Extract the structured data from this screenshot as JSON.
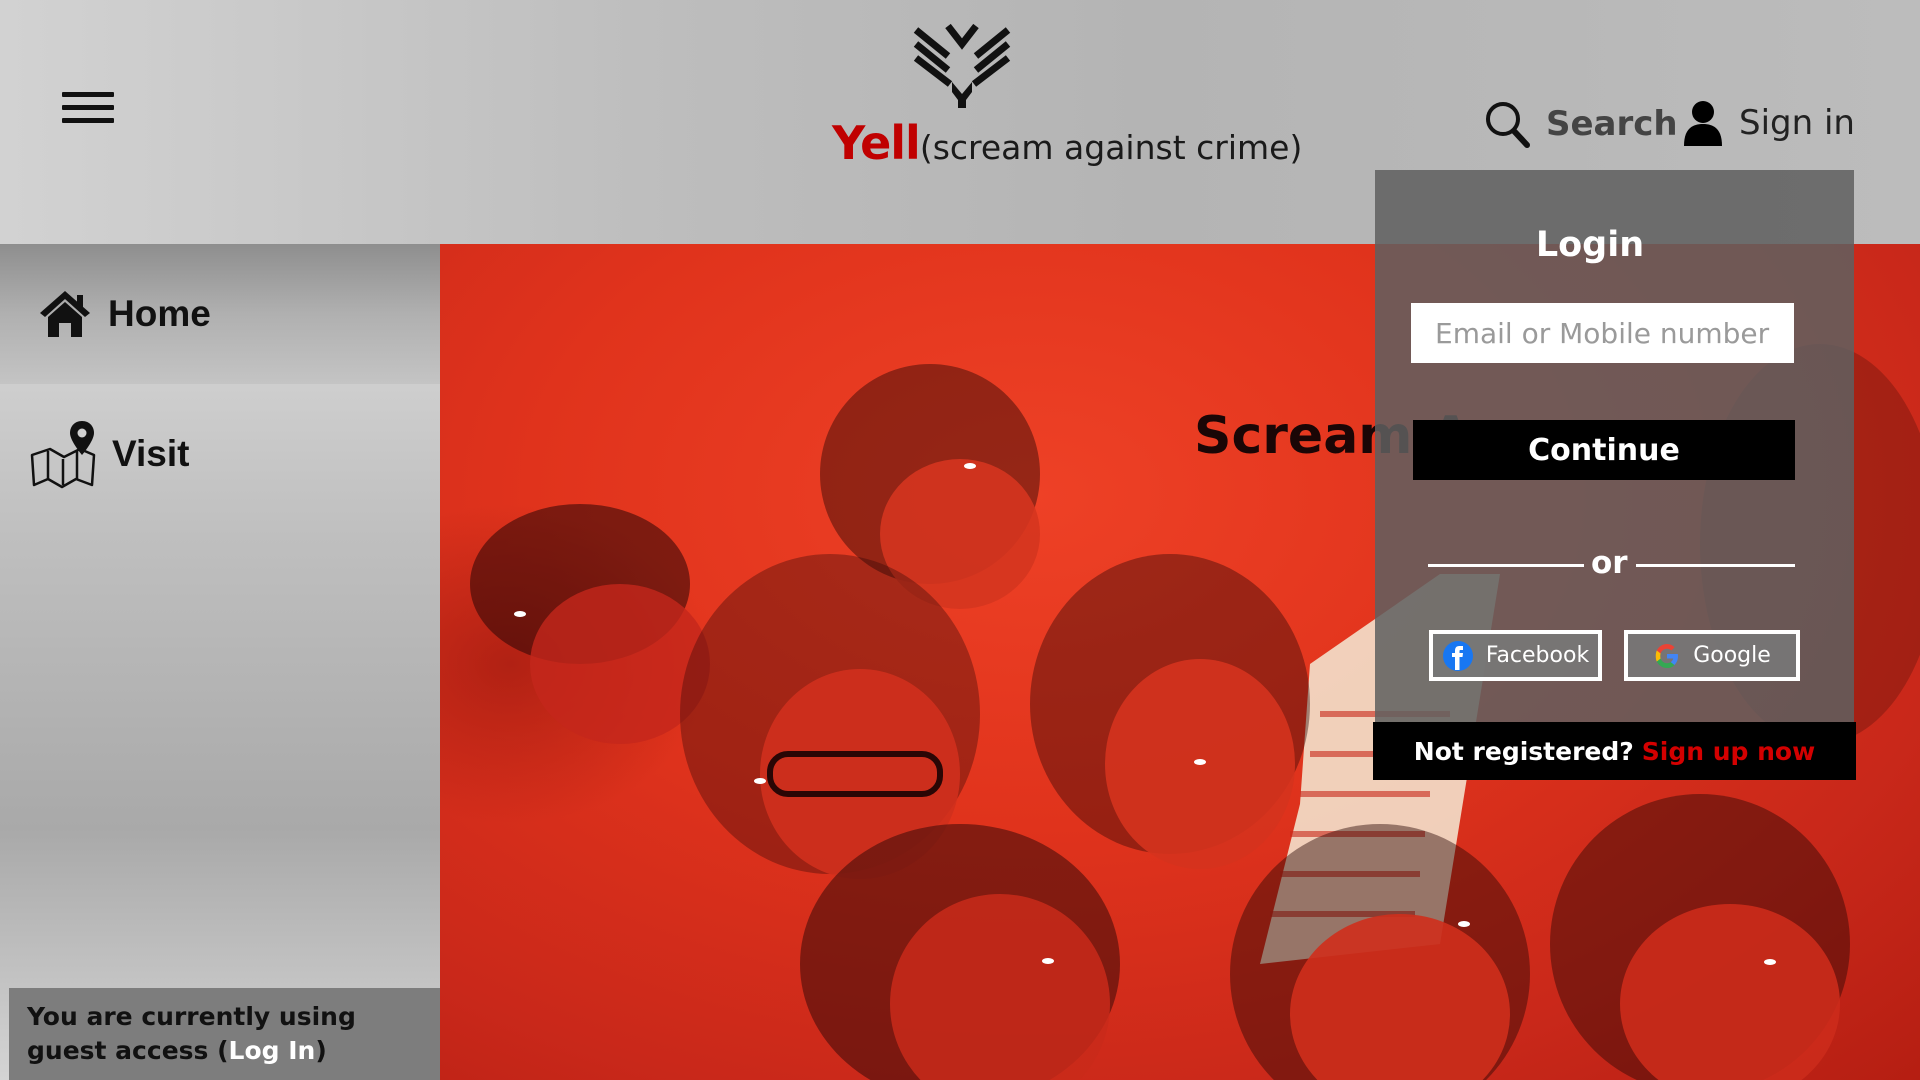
{
  "header": {
    "brand_name": "Yell",
    "brand_tagline": "(scream against crime)",
    "search_label": "Search",
    "signin_label": "Sign in"
  },
  "sidebar": {
    "items": [
      {
        "label": "Home",
        "icon": "home-icon"
      },
      {
        "label": "Visit",
        "icon": "map-pin-icon"
      }
    ],
    "guest_text": "You are currently using guest access (",
    "guest_link": "Log In",
    "guest_suffix": ")"
  },
  "hero": {
    "title": "Scream A"
  },
  "login": {
    "title": "Login",
    "email_placeholder": "Email or Mobile number",
    "continue_label": "Continue",
    "or_label": "or",
    "facebook_label": "Facebook",
    "google_label": "Google",
    "not_registered": "Not registered?",
    "signup_label": "Sign up now"
  },
  "colors": {
    "brand_red": "#c00000",
    "hero_red": "#e0331c",
    "signup_link": "#d40000"
  }
}
